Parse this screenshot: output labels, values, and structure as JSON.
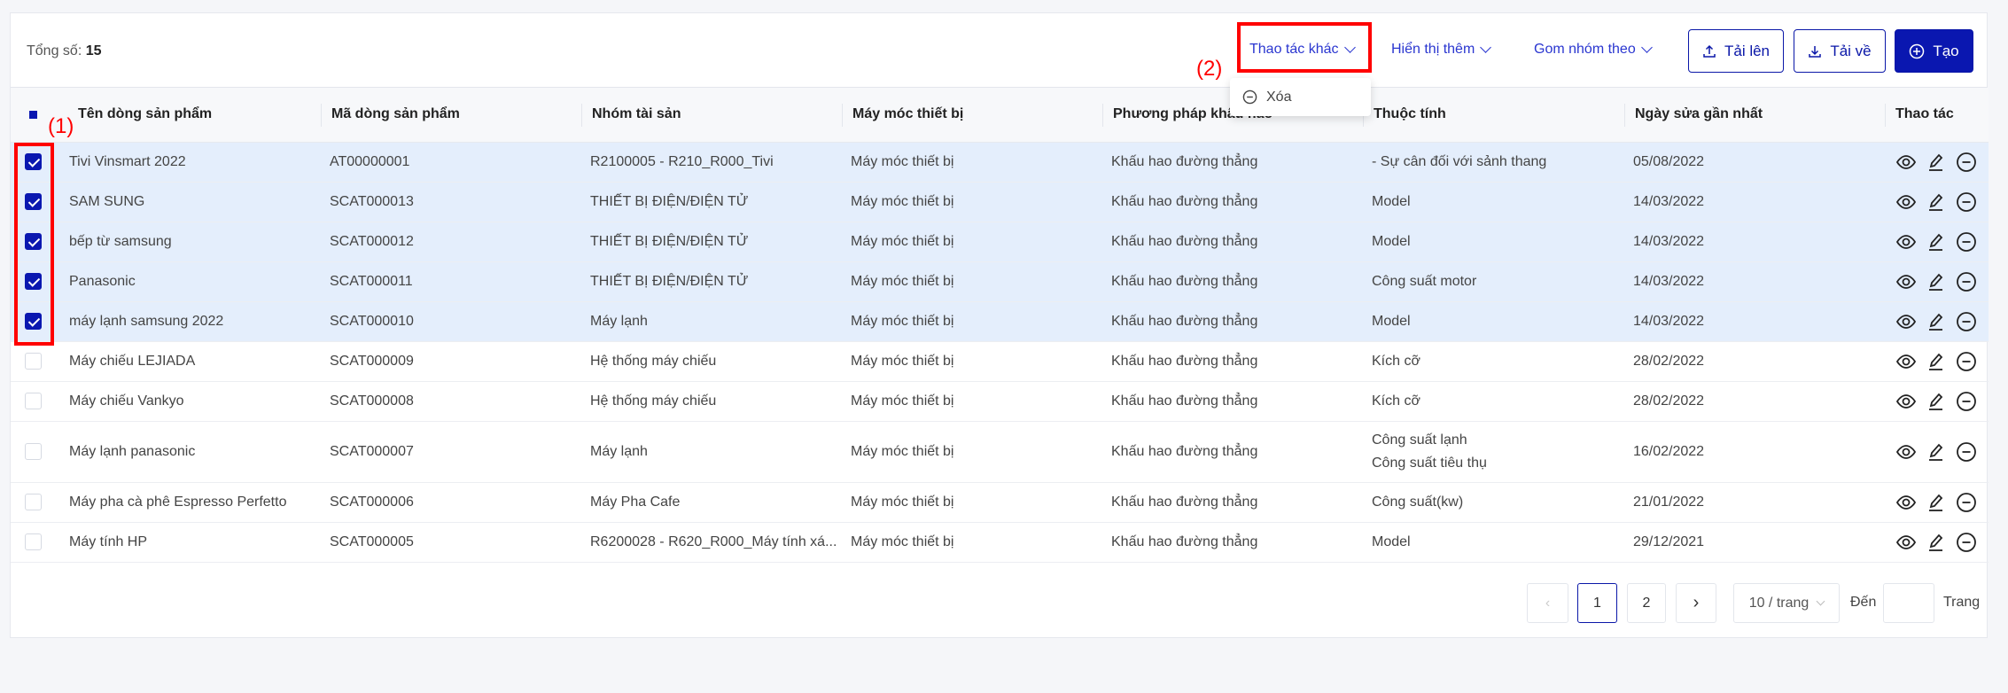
{
  "toolbar": {
    "total_label": "Tổng số:",
    "total_value": "15",
    "more_actions": "Thao tác khác",
    "show_more": "Hiển thị thêm",
    "group_by": "Gom nhóm theo",
    "upload": "Tải lên",
    "download": "Tải về",
    "create": "Tạo"
  },
  "dropdown": {
    "delete": "Xóa"
  },
  "annotations": {
    "one": "(1)",
    "two": "(2)"
  },
  "columns": [
    "Tên dòng sản phẩm",
    "Mã dòng sản phẩm",
    "Nhóm tài sản",
    "Máy móc thiết bị",
    "Phương pháp khấu hao",
    "Thuộc tính",
    "Ngày sửa gần nhất",
    "Thao tác"
  ],
  "rows": [
    {
      "checked": true,
      "name": "Tivi Vinsmart 2022",
      "code": "AT00000001",
      "group": "R2100005 - R210_R000_Tivi",
      "machine": "Máy móc thiết bị",
      "method": "Khấu hao đường thẳng",
      "attrs": [
        "- Sự cân đối với sảnh thang"
      ],
      "date": "05/08/2022"
    },
    {
      "checked": true,
      "name": "SAM SUNG",
      "code": "SCAT000013",
      "group": "THIẾT BỊ ĐIỆN/ĐIỆN TỬ",
      "machine": "Máy móc thiết bị",
      "method": "Khấu hao đường thẳng",
      "attrs": [
        "Model"
      ],
      "date": "14/03/2022"
    },
    {
      "checked": true,
      "name": "bếp từ samsung",
      "code": "SCAT000012",
      "group": "THIẾT BỊ ĐIỆN/ĐIỆN TỬ",
      "machine": "Máy móc thiết bị",
      "method": "Khấu hao đường thẳng",
      "attrs": [
        "Model"
      ],
      "date": "14/03/2022"
    },
    {
      "checked": true,
      "name": "Panasonic",
      "code": "SCAT000011",
      "group": "THIẾT BỊ ĐIỆN/ĐIỆN TỬ",
      "machine": "Máy móc thiết bị",
      "method": "Khấu hao đường thẳng",
      "attrs": [
        "Công suất motor"
      ],
      "date": "14/03/2022"
    },
    {
      "checked": true,
      "name": "máy lạnh samsung 2022",
      "code": "SCAT000010",
      "group": "Máy lạnh",
      "machine": "Máy móc thiết bị",
      "method": "Khấu hao đường thẳng",
      "attrs": [
        "Model"
      ],
      "date": "14/03/2022"
    },
    {
      "checked": false,
      "name": "Máy chiếu LEJIADA",
      "code": "SCAT000009",
      "group": "Hệ thống máy chiếu",
      "machine": "Máy móc thiết bị",
      "method": "Khấu hao đường thẳng",
      "attrs": [
        "Kích cỡ"
      ],
      "date": "28/02/2022"
    },
    {
      "checked": false,
      "name": "Máy chiếu Vankyo",
      "code": "SCAT000008",
      "group": "Hệ thống máy chiếu",
      "machine": "Máy móc thiết bị",
      "method": "Khấu hao đường thẳng",
      "attrs": [
        "Kích cỡ"
      ],
      "date": "28/02/2022"
    },
    {
      "checked": false,
      "name": "Máy lạnh panasonic",
      "code": "SCAT000007",
      "group": "Máy lạnh",
      "machine": "Máy móc thiết bị",
      "method": "Khấu hao đường thẳng",
      "attrs": [
        "Công suất lạnh",
        "Công suất tiêu thụ"
      ],
      "date": "16/02/2022"
    },
    {
      "checked": false,
      "name": "Máy pha cà phê Espresso Perfetto",
      "code": "SCAT000006",
      "group": "Máy Pha Cafe",
      "machine": "Máy móc thiết bị",
      "method": "Khấu hao đường thẳng",
      "attrs": [
        "Công suất(kw)"
      ],
      "date": "21/01/2022"
    },
    {
      "checked": false,
      "name": "Máy tính HP",
      "code": "SCAT000005",
      "group": "R6200028 - R620_R000_Máy tính xá...",
      "machine": "Máy móc thiết bị",
      "method": "Khấu hao đường thẳng",
      "attrs": [
        "Model"
      ],
      "date": "29/12/2021"
    }
  ],
  "pagination": {
    "pages": [
      "1",
      "2"
    ],
    "current": "1",
    "page_size": "10 / trang",
    "goto_label": "Đến",
    "goto_value": "",
    "page_suffix": "Trang"
  }
}
